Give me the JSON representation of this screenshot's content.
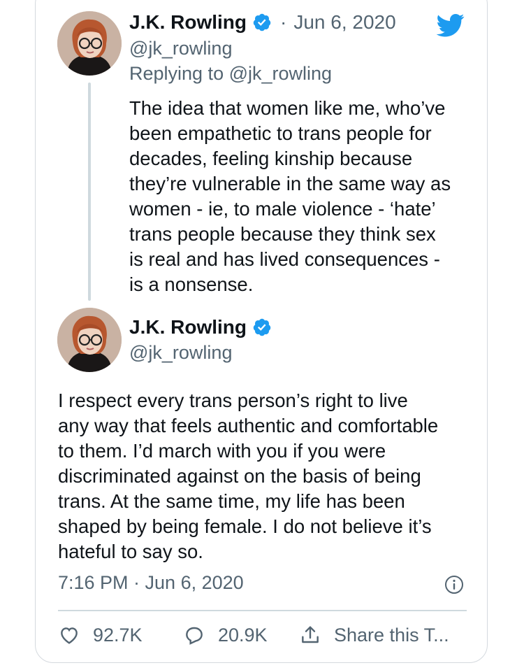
{
  "colors": {
    "twitter_blue": "#1d9bf0",
    "text_primary": "#0f1419",
    "text_secondary": "#536471",
    "border": "#cfd9de"
  },
  "reply_tweet": {
    "author_name": "J.K. Rowling",
    "verified_icon": "verified-badge-icon",
    "separator": "·",
    "date": "Jun 6, 2020",
    "handle": "@jk_rowling",
    "replying_prefix": "Replying to ",
    "replying_mention": "@jk_rowling",
    "lines": [
      "The idea that women like me, who’ve",
      "been empathetic to trans people for",
      "decades, feeling kinship because",
      "they’re vulnerable in the same way as",
      "women - ie, to male violence - ‘hate’",
      "trans people because they think sex",
      "is real and has lived consequences -",
      "is a nonsense."
    ]
  },
  "main_tweet": {
    "author_name": "J.K. Rowling",
    "verified_icon": "verified-badge-icon",
    "handle": "@jk_rowling",
    "lines": [
      "I respect every trans person’s right to live",
      "any way that feels authentic and comfortable",
      "to them. I’d march with you if you were",
      "discriminated against on the basis of being",
      "trans. At the same time, my life has been",
      "shaped by being female. I do not believe it’s",
      "hateful to say so."
    ],
    "timestamp": "7:16 PM · Jun 6, 2020",
    "info_icon": "info-icon"
  },
  "actions": {
    "like_icon": "heart-icon",
    "likes": "92.7K",
    "reply_icon": "reply-bubble-icon",
    "replies": "20.9K",
    "share_icon": "share-icon",
    "share_label": "Share this T..."
  },
  "logo_icon": "twitter-bird-icon"
}
